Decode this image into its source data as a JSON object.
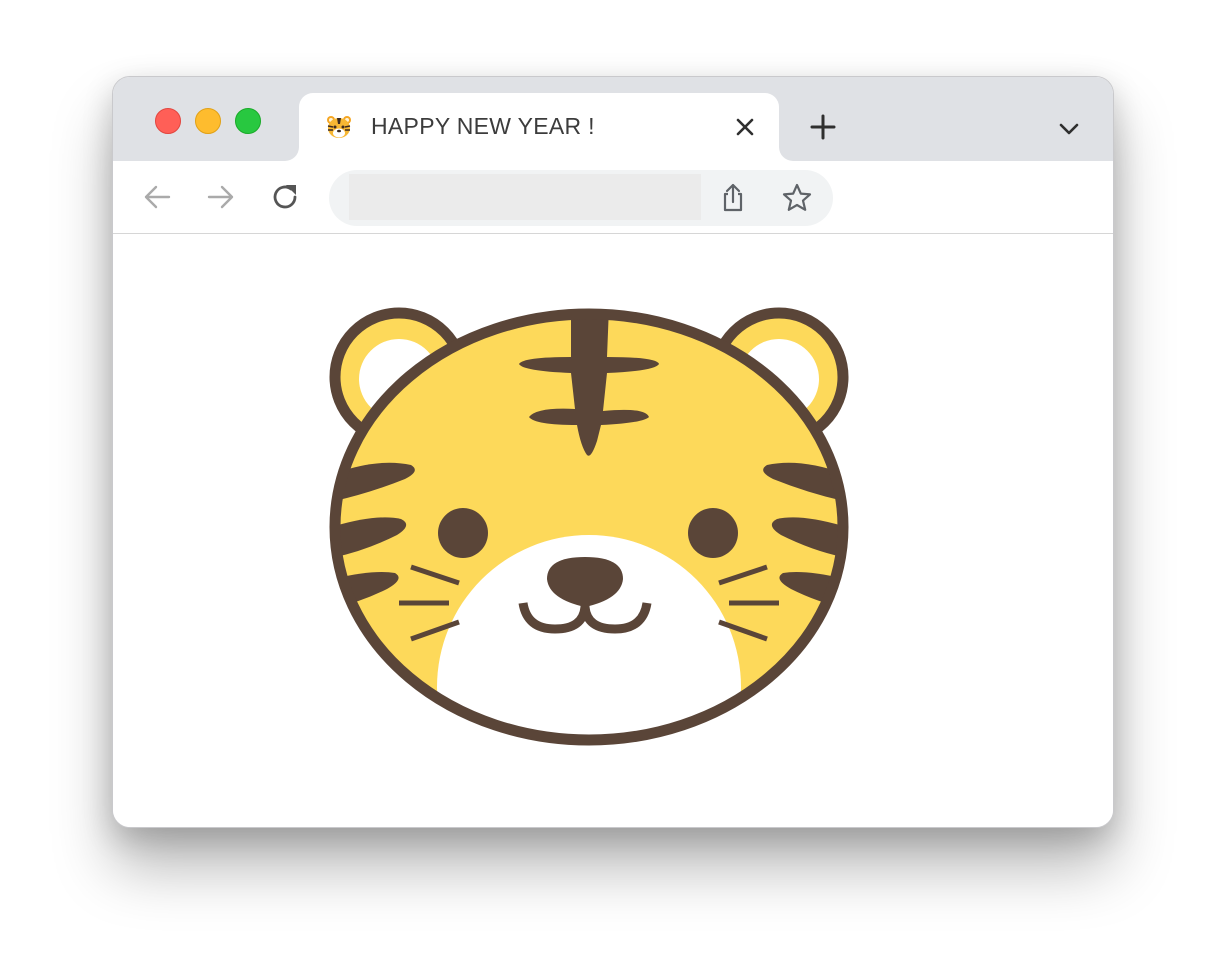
{
  "window": {
    "traffic_lights": [
      "close",
      "minimize",
      "maximize"
    ]
  },
  "tab": {
    "favicon": "tiger-face-emoji",
    "title": "HAPPY NEW YEAR !",
    "close_icon": "close-icon"
  },
  "tabbar": {
    "new_tab_icon": "plus-icon",
    "tab_menu_icon": "chevron-down-icon"
  },
  "toolbar": {
    "back_icon": "arrow-left-icon",
    "forward_icon": "arrow-right-icon",
    "reload_icon": "reload-icon",
    "address": {
      "value": "",
      "placeholder": ""
    },
    "share_icon": "share-icon",
    "bookmark_icon": "star-icon"
  },
  "page": {
    "illustration": "tiger-face-illustration"
  },
  "colors": {
    "tiger_yellow": "#fdd95a",
    "tiger_brown": "#5a4538",
    "titlebar": "#dfe1e5",
    "close_red": "#ff5f57",
    "minimize_yellow": "#febc2e",
    "maximize_green": "#28c840"
  }
}
